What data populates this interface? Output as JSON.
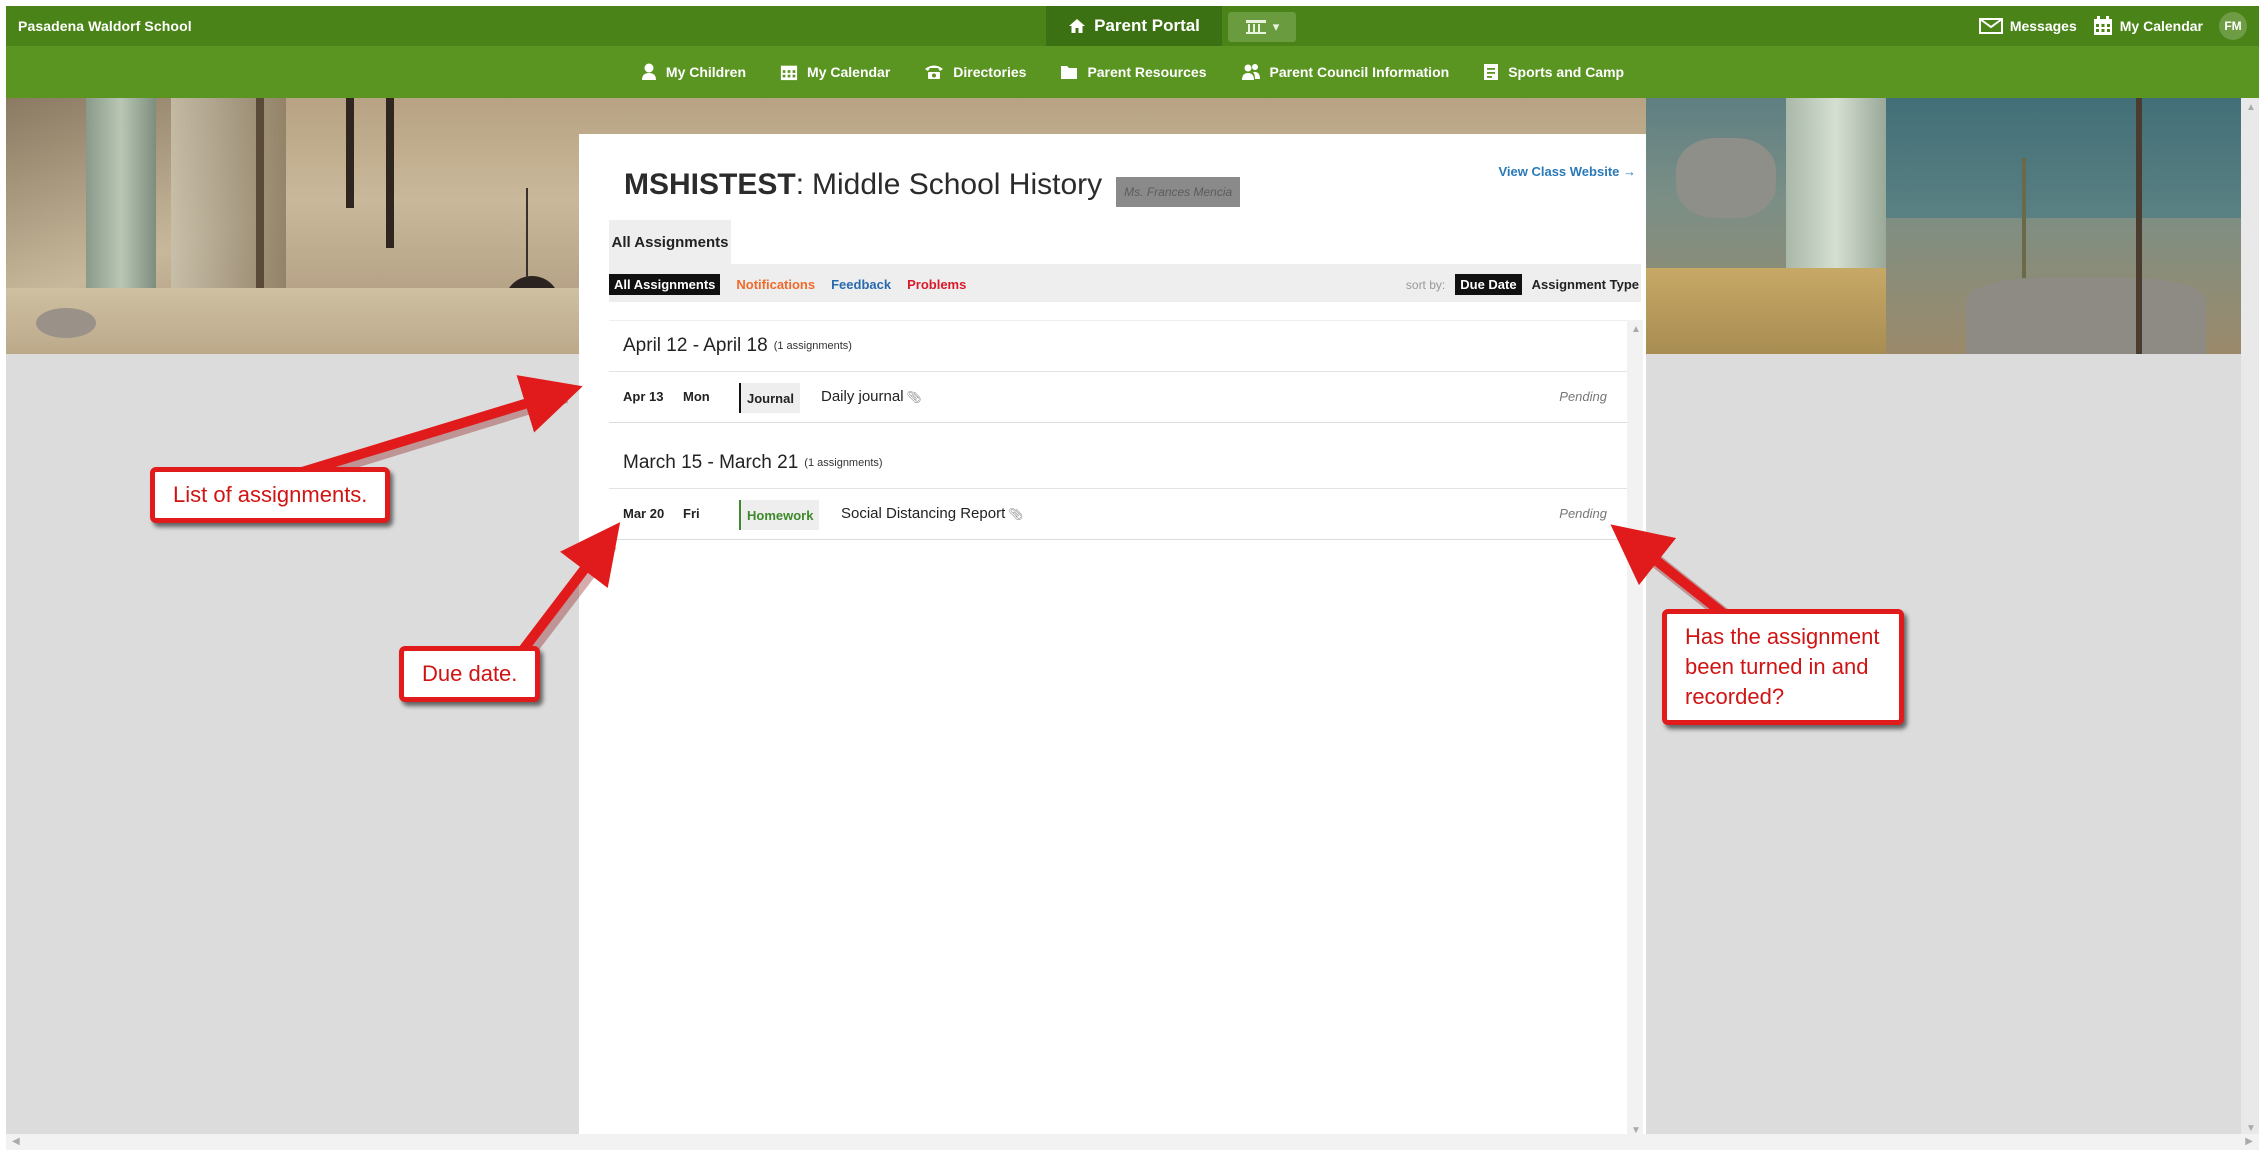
{
  "topbar": {
    "school_name": "Pasadena Waldorf School",
    "portal_label": "Parent Portal",
    "messages_label": "Messages",
    "calendar_label": "My Calendar",
    "avatar_initials": "FM"
  },
  "nav": {
    "items": [
      {
        "label": "My Children",
        "icon": "person-icon"
      },
      {
        "label": "My Calendar",
        "icon": "calendar-icon"
      },
      {
        "label": "Directories",
        "icon": "phone-icon"
      },
      {
        "label": "Parent Resources",
        "icon": "folder-icon"
      },
      {
        "label": "Parent Council Information",
        "icon": "people-icon"
      },
      {
        "label": "Sports and Camp",
        "icon": "document-icon"
      }
    ]
  },
  "course": {
    "code": "MSHISTEST",
    "separator": ":",
    "name": "Middle School History",
    "teacher": "Ms. Frances Mencia",
    "view_site_label": "View Class Website →"
  },
  "tabs": {
    "main": "All Assignments"
  },
  "filters": {
    "all": "All Assignments",
    "notifications": "Notifications",
    "feedback": "Feedback",
    "problems": "Problems",
    "sort_by_label": "sort by:",
    "sort_due_date": "Due Date",
    "sort_type": "Assignment Type"
  },
  "weeks": [
    {
      "range": "April 12 - April 18",
      "count": "(1 assignments)",
      "assignment": {
        "date": "Apr 13",
        "day": "Mon",
        "type": "Journal",
        "name": "Daily journal",
        "status": "Pending"
      }
    },
    {
      "range": "March 15 - March 21",
      "count": "(1 assignments)",
      "assignment": {
        "date": "Mar 20",
        "day": "Fri",
        "type": "Homework",
        "name": "Social Distancing Report",
        "status": "Pending"
      }
    }
  ],
  "callouts": {
    "list": "List of assignments.",
    "due": "Due date.",
    "status_line1": "Has the assignment",
    "status_line2": "been turned in and",
    "status_line3": "recorded?"
  },
  "colors": {
    "topbar": "#4a8318",
    "navbar": "#5a9421",
    "callout_red": "#e11b1b"
  }
}
